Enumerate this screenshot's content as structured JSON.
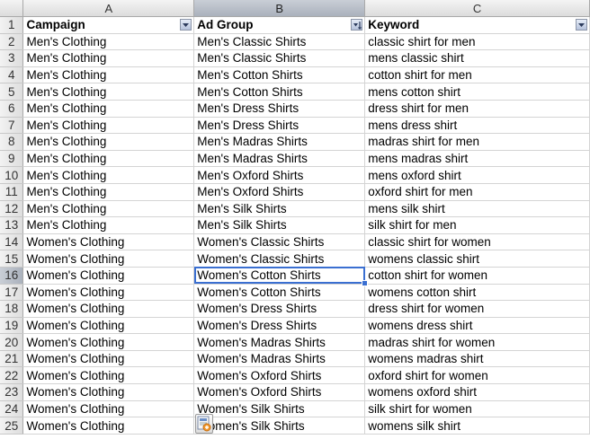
{
  "columns": [
    "A",
    "B",
    "C"
  ],
  "header": {
    "row_number": "1",
    "campaign": "Campaign",
    "ad_group": "Ad Group",
    "keyword": "Keyword"
  },
  "rows": [
    {
      "n": "2",
      "campaign": "Men's Clothing",
      "ad_group": "Men's Classic Shirts",
      "keyword": "classic shirt for men"
    },
    {
      "n": "3",
      "campaign": "Men's Clothing",
      "ad_group": "Men's Classic Shirts",
      "keyword": "mens classic shirt"
    },
    {
      "n": "4",
      "campaign": "Men's Clothing",
      "ad_group": "Men's Cotton Shirts",
      "keyword": "cotton shirt for men"
    },
    {
      "n": "5",
      "campaign": "Men's Clothing",
      "ad_group": "Men's Cotton Shirts",
      "keyword": "mens cotton shirt"
    },
    {
      "n": "6",
      "campaign": "Men's Clothing",
      "ad_group": "Men's Dress Shirts",
      "keyword": "dress shirt for men"
    },
    {
      "n": "7",
      "campaign": "Men's Clothing",
      "ad_group": "Men's Dress Shirts",
      "keyword": "mens dress shirt"
    },
    {
      "n": "8",
      "campaign": "Men's Clothing",
      "ad_group": "Men's Madras Shirts",
      "keyword": "madras shirt for men"
    },
    {
      "n": "9",
      "campaign": "Men's Clothing",
      "ad_group": "Men's Madras Shirts",
      "keyword": "mens madras shirt"
    },
    {
      "n": "10",
      "campaign": "Men's Clothing",
      "ad_group": "Men's Oxford Shirts",
      "keyword": "mens oxford shirt"
    },
    {
      "n": "11",
      "campaign": "Men's Clothing",
      "ad_group": "Men's Oxford Shirts",
      "keyword": "oxford shirt for men"
    },
    {
      "n": "12",
      "campaign": "Men's Clothing",
      "ad_group": "Men's Silk Shirts",
      "keyword": "mens silk shirt"
    },
    {
      "n": "13",
      "campaign": "Men's Clothing",
      "ad_group": "Men's Silk Shirts",
      "keyword": "silk shirt for men"
    },
    {
      "n": "14",
      "campaign": "Women's Clothing",
      "ad_group": "Women's Classic Shirts",
      "keyword": "classic shirt for women"
    },
    {
      "n": "15",
      "campaign": "Women's Clothing",
      "ad_group": "Women's Classic Shirts",
      "keyword": "womens classic shirt"
    },
    {
      "n": "16",
      "campaign": "Women's Clothing",
      "ad_group": "Women's Cotton Shirts",
      "keyword": "cotton shirt for women"
    },
    {
      "n": "17",
      "campaign": "Women's Clothing",
      "ad_group": "Women's Cotton Shirts",
      "keyword": "womens cotton shirt"
    },
    {
      "n": "18",
      "campaign": "Women's Clothing",
      "ad_group": "Women's Dress Shirts",
      "keyword": "dress shirt for women"
    },
    {
      "n": "19",
      "campaign": "Women's Clothing",
      "ad_group": "Women's Dress Shirts",
      "keyword": "womens dress shirt"
    },
    {
      "n": "20",
      "campaign": "Women's Clothing",
      "ad_group": "Women's Madras Shirts",
      "keyword": "madras shirt for women"
    },
    {
      "n": "21",
      "campaign": "Women's Clothing",
      "ad_group": "Women's Madras Shirts",
      "keyword": "womens madras shirt"
    },
    {
      "n": "22",
      "campaign": "Women's Clothing",
      "ad_group": "Women's Oxford Shirts",
      "keyword": "oxford shirt for women"
    },
    {
      "n": "23",
      "campaign": "Women's Clothing",
      "ad_group": "Women's Oxford Shirts",
      "keyword": "womens oxford shirt"
    },
    {
      "n": "24",
      "campaign": "Women's Clothing",
      "ad_group": "Women's Silk Shirts",
      "keyword": "silk shirt for women"
    },
    {
      "n": "25",
      "campaign": "Women's Clothing",
      "ad_group": "Women's Silk Shirts",
      "keyword": "womens silk shirt"
    }
  ],
  "active_cell": "B16",
  "selected_column": "B",
  "icons": {
    "filter_campaign": "dropdown-arrow-icon",
    "filter_ad_group": "sort-filter-icon",
    "filter_keyword": "dropdown-arrow-icon",
    "paste": "paste-options-icon"
  },
  "colors": {
    "selection": "#3a6fd1",
    "grid": "#d4d4d4"
  }
}
